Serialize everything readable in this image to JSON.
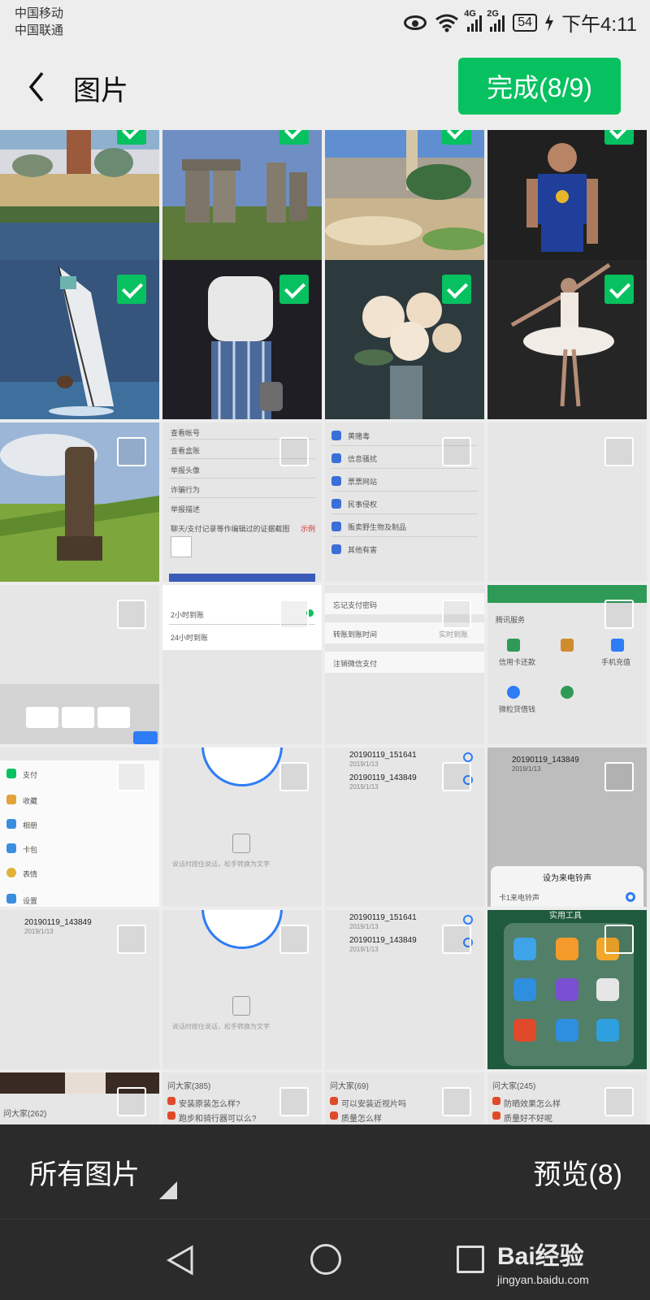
{
  "status_bar": {
    "carrier_1": "中国移动",
    "carrier_2": "中国联通",
    "sim1_network": "4G",
    "sim2_network": "2G",
    "battery": "54",
    "time": "下午4:11"
  },
  "header": {
    "title": "图片",
    "done_label": "完成(8/9)"
  },
  "colors": {
    "accent": "#07c160",
    "bottom_bar": "#2b2b2b",
    "background": "#ededed"
  },
  "photos": [
    {
      "subject": "city-harbor-photo",
      "checked": true
    },
    {
      "subject": "stonehenge-photo",
      "checked": true
    },
    {
      "subject": "park-guell-photo",
      "checked": true
    },
    {
      "subject": "basketball-player-photo",
      "checked": true
    },
    {
      "subject": "windsurfer-photo",
      "checked": true
    },
    {
      "subject": "fashion-model-photo",
      "checked": true
    },
    {
      "subject": "rose-bouquet-photo",
      "checked": true
    },
    {
      "subject": "ballerina-photo",
      "checked": true
    },
    {
      "subject": "moai-statue-photo",
      "checked": false
    }
  ],
  "screenshots": {
    "s1": [
      "查看帐号",
      "查看盒账",
      "举报头像",
      "诈骗行为",
      "举报描述",
      "聊天/支付记录等作编辑过的证据截图",
      "示例"
    ],
    "s2": [
      "黄赌毒",
      "信息骚扰",
      "票票网站",
      "民事侵权",
      "贩卖野生物及制品",
      "其他有害"
    ],
    "s4": [
      "2小时到账",
      "24小时到账"
    ],
    "s5": [
      "忘记支付密码",
      "转账到账时间",
      "实时到账",
      "注销微信支付"
    ],
    "s6": [
      "腾讯服务",
      "信用卡还款",
      "手机充值",
      "微粒贷借钱"
    ],
    "s7": [
      "支付",
      "收藏",
      "相册",
      "卡包",
      "表情",
      "设置"
    ],
    "s8": [
      "说话时按住说话，松手转换为文字"
    ],
    "s9_title": "20190119_151641",
    "s9_title2": "20190119_143849",
    "s9_meta": "2019/1/13",
    "s10_title": "20190119_143849",
    "s10_menu": "设为来电铃声",
    "s10_item": "卡1来电铃声",
    "s11_title": "20190119_143849",
    "s13_tools": "实用工具",
    "s14_caption": "问大家(262)",
    "s15_header": "问大家(385)",
    "s15_q1": "安装原装怎么样?",
    "s15_q2": "跑步和骑行器可以么?",
    "s16_header": "问大家(69)",
    "s16_q1": "可以安装近视片吗",
    "s16_q2": "质量怎么样",
    "s17_header": "问大家(245)",
    "s17_q1": "防晒效果怎么样",
    "s17_q2": "质量好不好呢"
  },
  "bottom_bar": {
    "album_label": "所有图片",
    "preview_label": "预览(8)"
  },
  "watermark": {
    "logo": "Bai经验",
    "url": "jingyan.baidu.com"
  }
}
